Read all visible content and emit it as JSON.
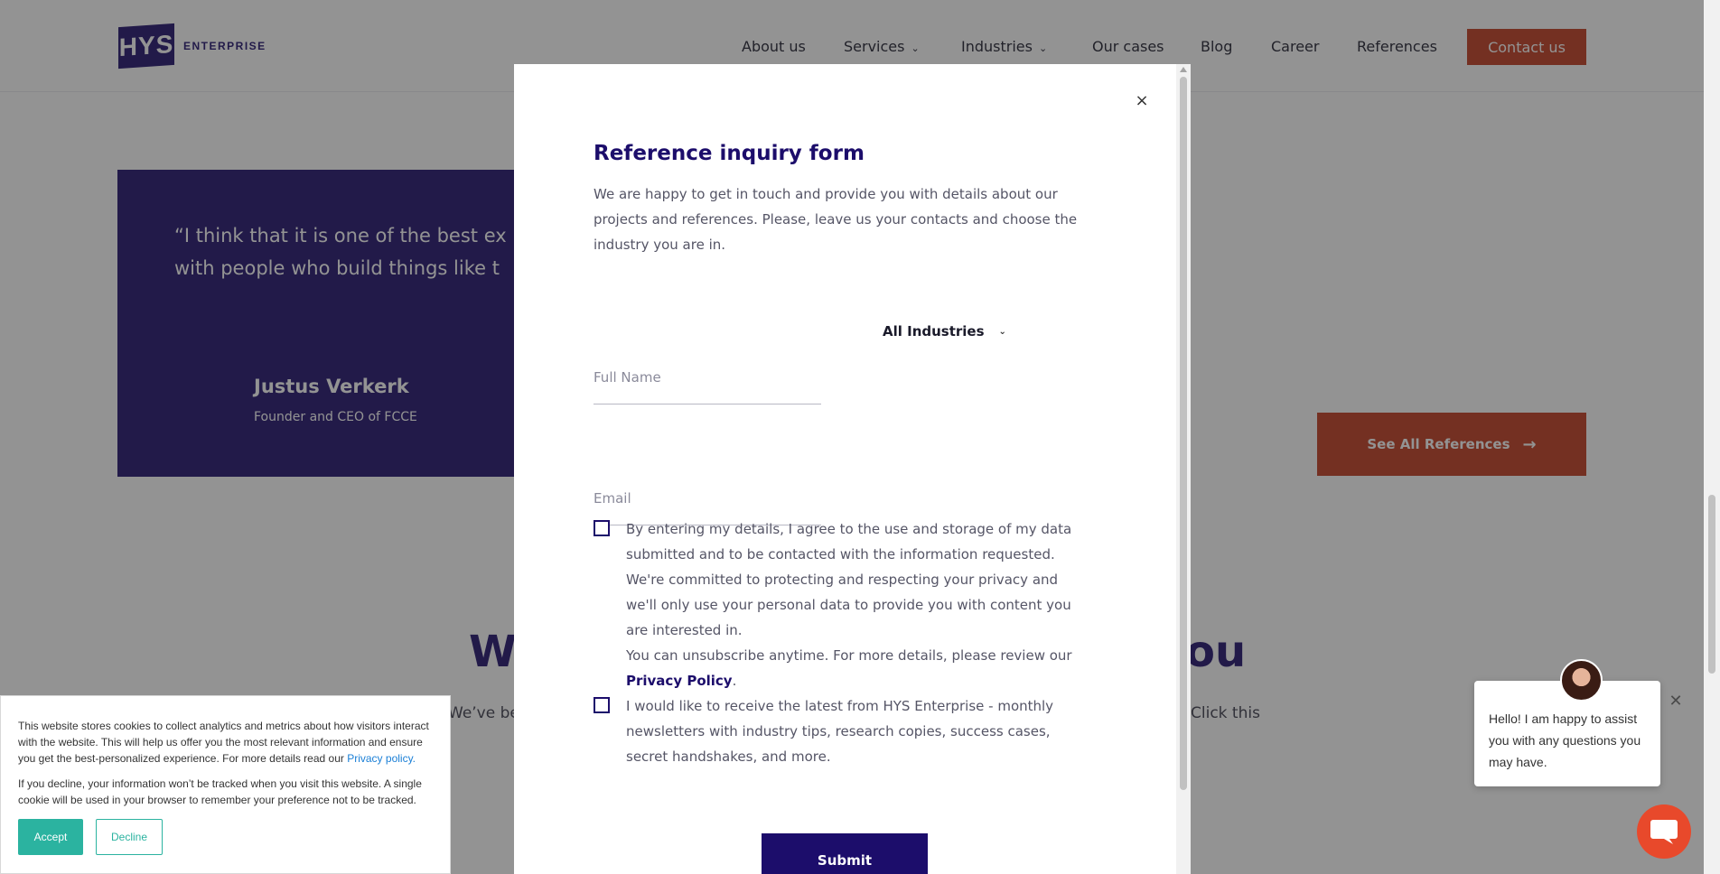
{
  "header": {
    "logo_mark": "HYS",
    "logo_text": "ENTERPRISE",
    "nav": [
      {
        "label": "About us"
      },
      {
        "label": "Services"
      },
      {
        "label": "Industries"
      },
      {
        "label": "Our cases"
      },
      {
        "label": "Blog"
      },
      {
        "label": "Career"
      },
      {
        "label": "References"
      }
    ],
    "contact_label": "Contact us"
  },
  "testimonial": {
    "quote": "“I think that it is one of the best experiences to work with people who build things like t",
    "quote_line1": "“I think that it is one of the best ex",
    "quote_line2": "with people who build things like t",
    "author": "Justus Verkerk",
    "role": "Founder and CEO of FCCE"
  },
  "see_all_label": "See All References",
  "section": {
    "title_left": "We",
    "title_right": "ou",
    "text_left": "We’ve bee",
    "text_right": "Click this"
  },
  "modal": {
    "title": "Reference inquiry form",
    "description": "We are happy to get in touch and provide you with details about our projects and references. Please, leave us your contacts and choose the industry you are in.",
    "full_name_placeholder": "Full Name",
    "email_placeholder": "Email",
    "industry_selected": "All Industries",
    "consent_text": "By entering my details, I agree to the use and storage of my data submitted and to be contacted with the information requested. We're committed to protecting and respecting your privacy and we'll only use your personal data to provide you with content you are interested in.",
    "unsubscribe_text": "You can unsubscribe anytime. For more details, please review our",
    "privacy_link": "Privacy Policy",
    "newsletter_text": "I would like to receive the latest from HYS Enterprise - monthly newsletters with industry tips, research copies, success cases, secret handshakes, and more.",
    "submit_label": "Submit",
    "close_glyph": "×"
  },
  "cookie": {
    "text1": "This website stores cookies to collect analytics and metrics about how visitors interact with the website. This will help us offer you the most relevant information and ensure you get the best-personalized experience. For more details read our",
    "privacy_link": "Privacy policy.",
    "text2": "If you decline, your information won’t be tracked when you visit this website. A single cookie will be used in your browser to remember your preference not to be tracked.",
    "accept_label": "Accept",
    "decline_label": "Decline"
  },
  "chat": {
    "message": "Hello! I am happy to assist you with any questions you may have.",
    "close_glyph": "✕"
  },
  "colors": {
    "brand_navy": "#1c0d6b",
    "accent_orange": "#c1391c",
    "cookie_teal": "#2bb3a0",
    "chat_orange": "#e8492b"
  }
}
